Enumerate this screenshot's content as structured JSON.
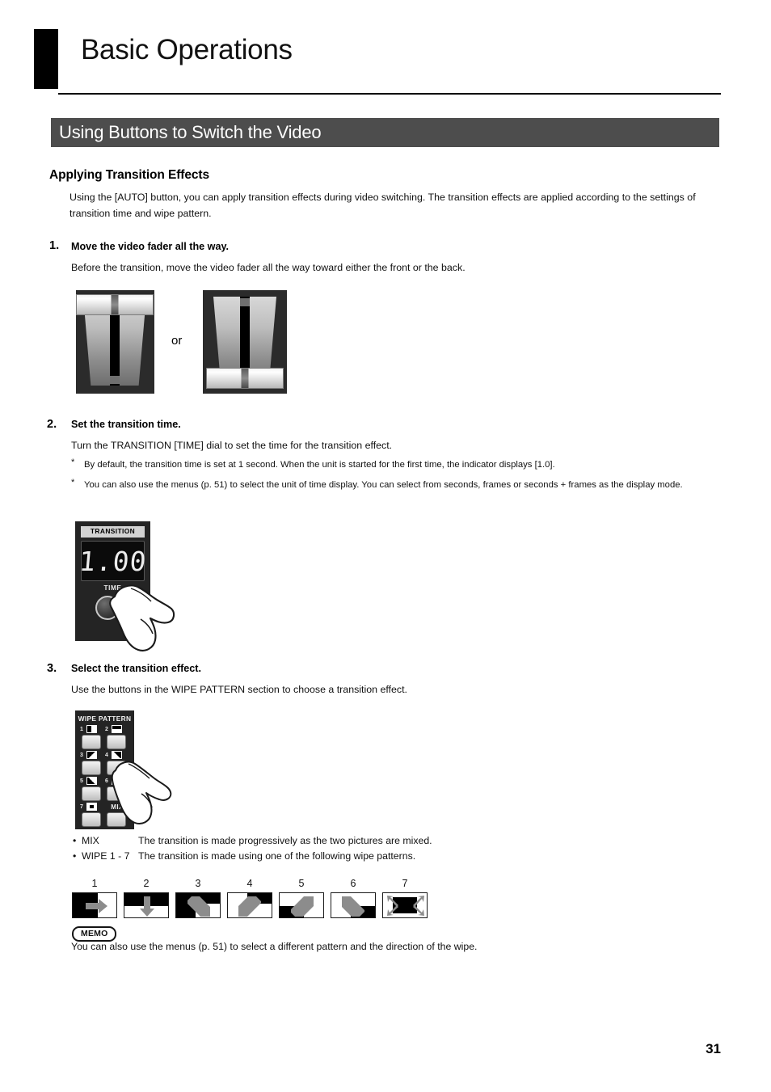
{
  "chapter": {
    "title": "Basic Operations"
  },
  "section": {
    "title": "Using Buttons to Switch the Video"
  },
  "subsection": {
    "heading": "Applying Transition Effects",
    "intro": "Using the [AUTO] button, you can apply transition effects during video switching. The transition effects are applied according to the settings of transition time and wipe pattern."
  },
  "steps": [
    {
      "number": "1.",
      "title": "Move the video fader all the way.",
      "body": "Before the transition, move the video fader all the way toward either the front or the back."
    },
    {
      "number": "2.",
      "title": "Set the transition time.",
      "body": "Turn the TRANSITION [TIME] dial to set the time for the transition effect.",
      "notes": [
        {
          "marker": "*",
          "text": "By default, the transition time is set at 1 second. When the unit is started for the first time, the indicator displays [1.0]."
        },
        {
          "marker": "*",
          "text": "You can also use the menus (p. 51) to select the unit of time display. You can select from seconds, frames or seconds + frames as the display mode."
        }
      ]
    },
    {
      "number": "3.",
      "title": "Select the transition effect.",
      "body": "Use the buttons in the WIPE PATTERN section to choose a transition effect."
    }
  ],
  "fader_figure": {
    "or_label": "or",
    "left_caption": "video-fader-forward",
    "right_caption": "video-fader-back"
  },
  "transition_panel": {
    "label": "TRANSITION",
    "display_value": "1.00",
    "time_label": "TIME"
  },
  "wipe_panel": {
    "title": "WIPE PATTERN",
    "buttons": [
      {
        "number": "1"
      },
      {
        "number": "2"
      },
      {
        "number": "3"
      },
      {
        "number": "4"
      },
      {
        "number": "5"
      },
      {
        "number": "6"
      },
      {
        "number": "7"
      },
      {
        "number": "MIX"
      }
    ]
  },
  "effect_descriptions": [
    {
      "bullet": "•",
      "name": "MIX",
      "text": "The transition is made progressively as the two pictures are mixed."
    },
    {
      "bullet": "•",
      "name": "WIPE 1 - 7",
      "text": "The transition is made using one of the following wipe patterns."
    }
  ],
  "wipe_patterns": [
    {
      "number": "1",
      "direction": "right"
    },
    {
      "number": "2",
      "direction": "down"
    },
    {
      "number": "3",
      "direction": "down-right"
    },
    {
      "number": "4",
      "direction": "down-left"
    },
    {
      "number": "5",
      "direction": "up-right"
    },
    {
      "number": "6",
      "direction": "up-left"
    },
    {
      "number": "7",
      "direction": "outward"
    }
  ],
  "memo": {
    "badge": "MEMO",
    "text": "You can also use the menus (p. 51) to select a different pattern and the direction of the wipe."
  },
  "footer": {
    "page_number": "31"
  },
  "colors": {
    "section_bar": "#4d4d4d",
    "panel_bg": "#242424",
    "accent_black": "#000000"
  }
}
